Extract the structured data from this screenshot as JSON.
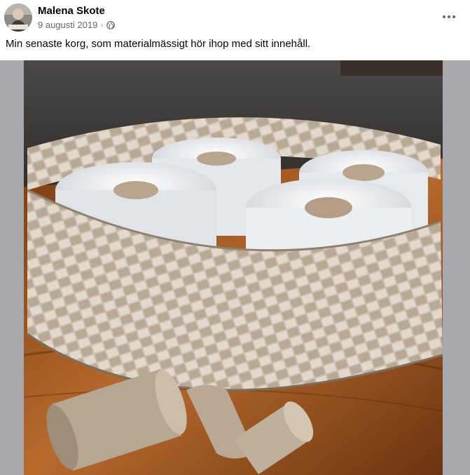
{
  "post": {
    "author": "Malena Skote",
    "date": "9 augusti 2019",
    "separator": "·",
    "audience_icon": "globe-icon",
    "more_icon": "more-horizontal-icon",
    "text": "Min senaste korg, som materialmässigt hör ihop med sitt innehåll."
  },
  "colors": {
    "text_primary": "#050505",
    "text_secondary": "#65676b",
    "media_background": "#a6a8ad"
  }
}
